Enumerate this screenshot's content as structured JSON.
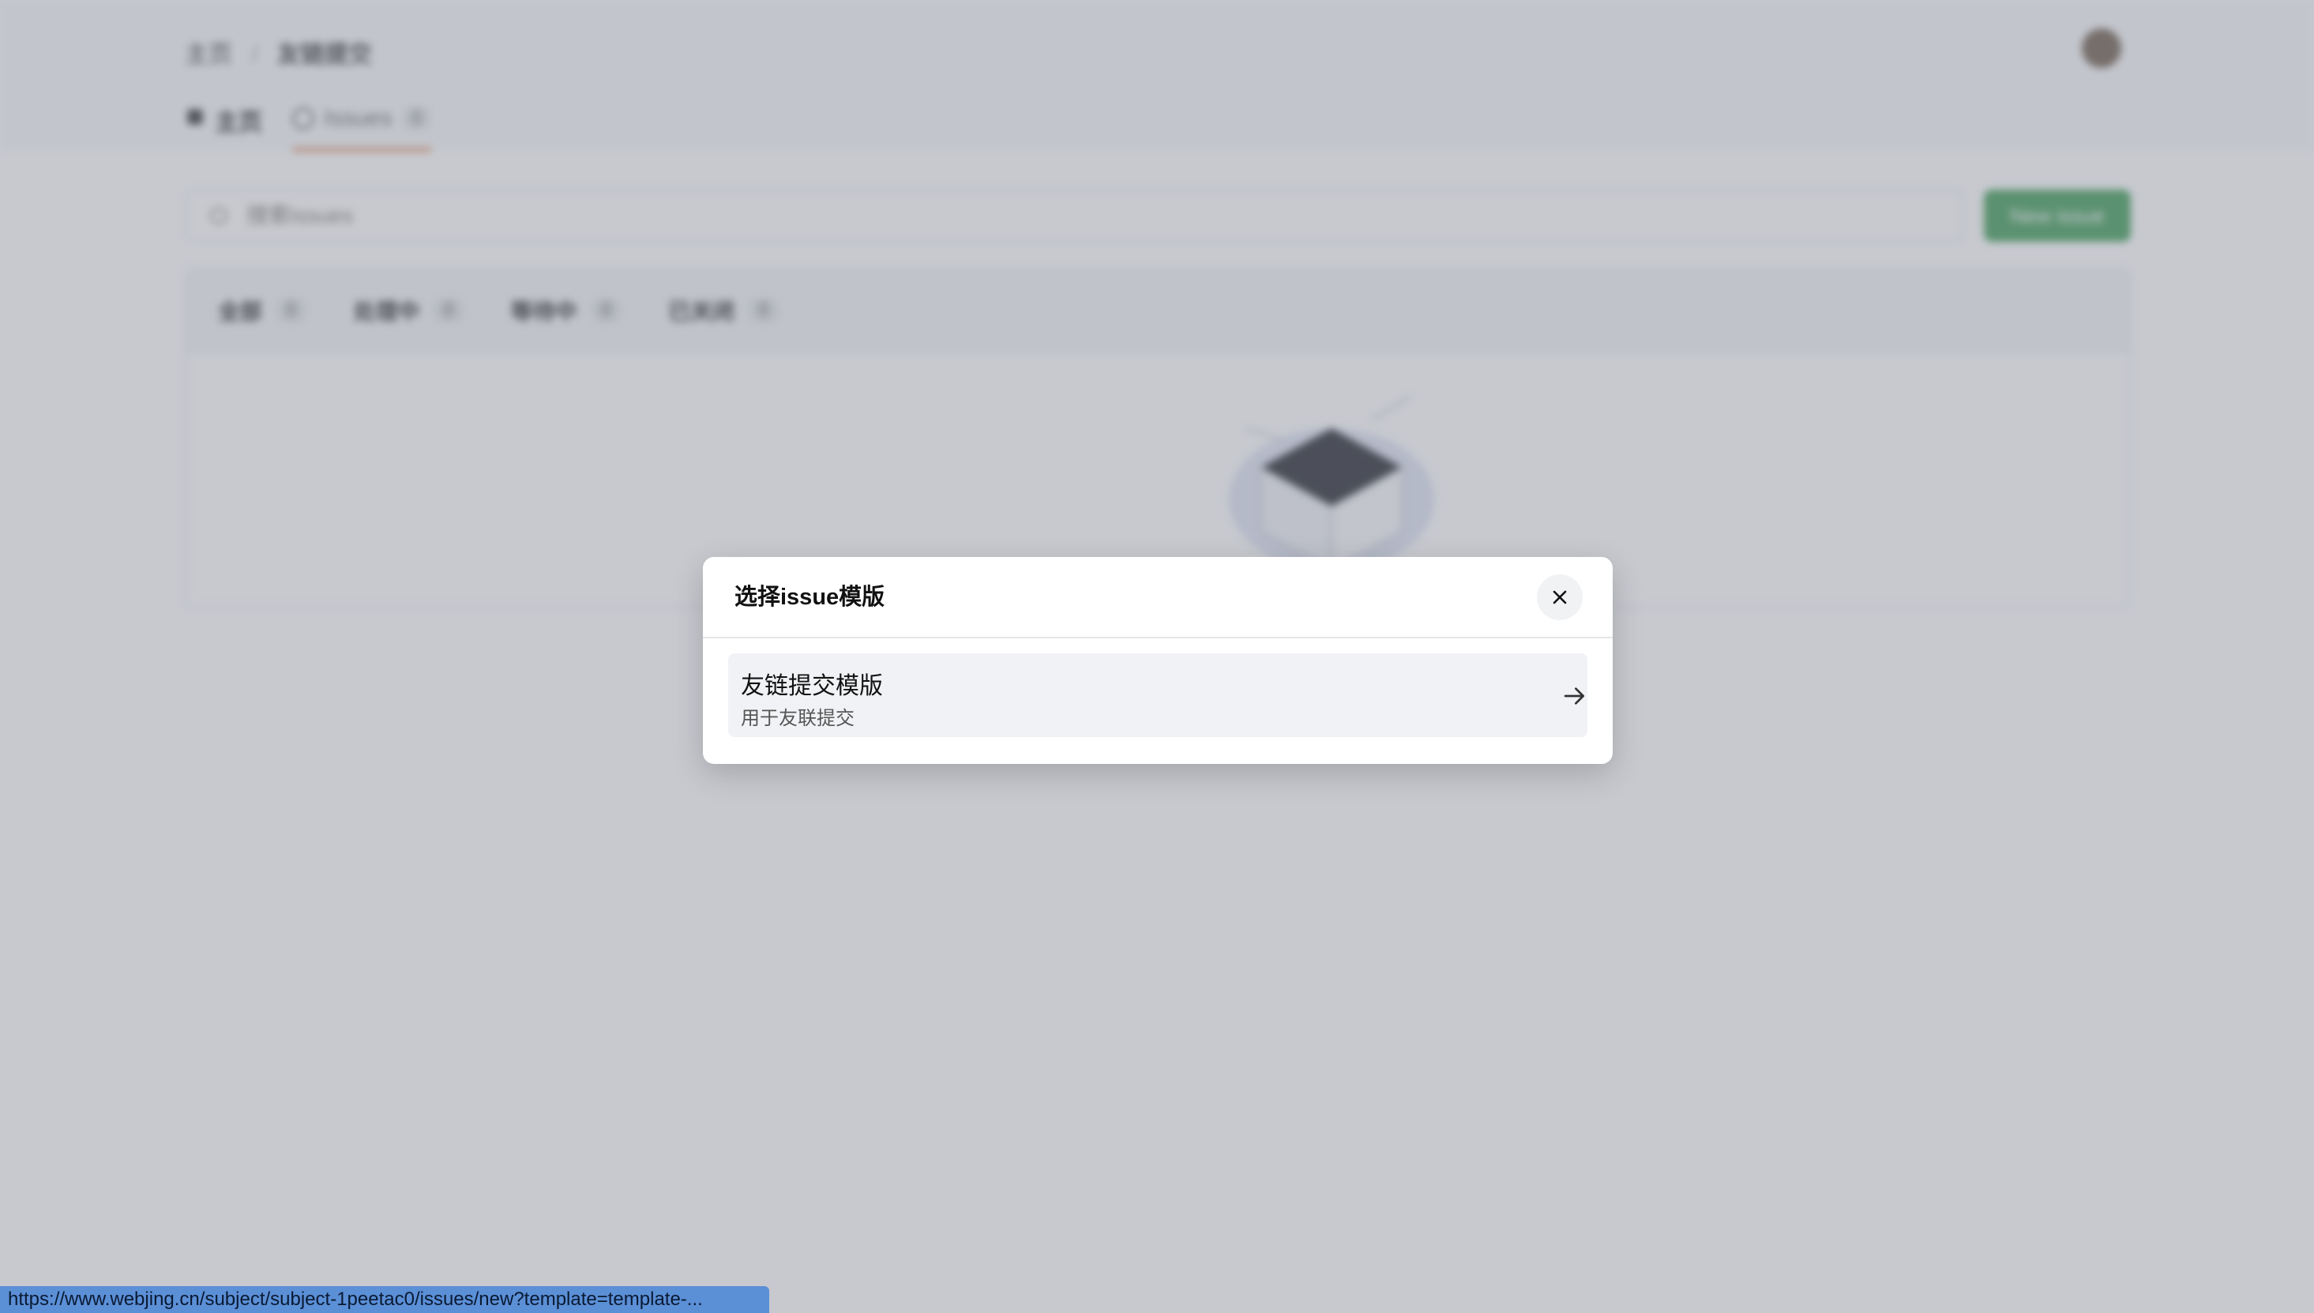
{
  "background": {
    "breadcrumb": {
      "root": "主页",
      "separator": "/",
      "current": "友链提交"
    },
    "tabs": [
      {
        "label": "主页"
      },
      {
        "label": "Issues",
        "badge": "0"
      }
    ],
    "search": {
      "placeholder": "搜索issues"
    },
    "new_issue_label": "New issue",
    "filters": [
      {
        "label": "全部",
        "count": "0"
      },
      {
        "label": "处理中",
        "count": "0"
      },
      {
        "label": "等待中",
        "count": "0"
      },
      {
        "label": "已关闭",
        "count": "0"
      }
    ]
  },
  "modal": {
    "title": "选择issue模版",
    "templates": [
      {
        "name": "友链提交模版",
        "description": "用于友联提交"
      }
    ]
  },
  "status_url": "https://www.webjing.cn/subject/subject-1peetac0/issues/new?template=template-..."
}
